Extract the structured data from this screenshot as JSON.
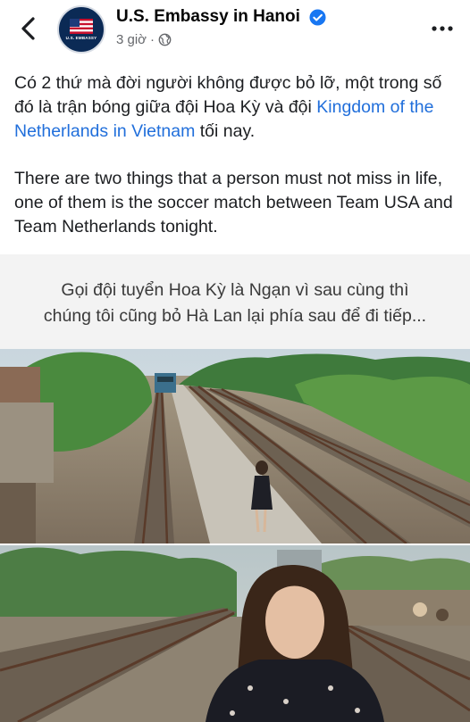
{
  "header": {
    "page_name": "U.S. Embassy in Hanoi",
    "time": "3 giờ",
    "separator": "·",
    "avatar_text": "U.S. EMBASSY",
    "icons": {
      "back": "chevron-left-icon",
      "verified": "verified-badge-icon",
      "audience": "globe-icon",
      "more": "more-dots-icon"
    }
  },
  "post": {
    "vi_text_before": "Có 2 thứ mà đời người không được bỏ lỡ, một trong số đó là trận bóng giữa đội Hoa Kỳ và đội ",
    "vi_mention": "Kingdom of the Netherlands in Vietnam",
    "vi_text_after": " tối nay.",
    "en_text": "There are two things that a person must not miss in life, one of them is the soccer match between Team USA and Team Netherlands tonight."
  },
  "image": {
    "quote_line1": "Gọi đội tuyển Hoa Kỳ là Ngạn vì sau cùng thì",
    "quote_line2": "chúng tôi cũng bỏ Hà Lan lại phía sau để đi tiếp..."
  },
  "colors": {
    "link": "#216fdb",
    "verified": "#1877f2",
    "secondary_text": "#65676b",
    "avatar_bg": "#0b2a55"
  }
}
